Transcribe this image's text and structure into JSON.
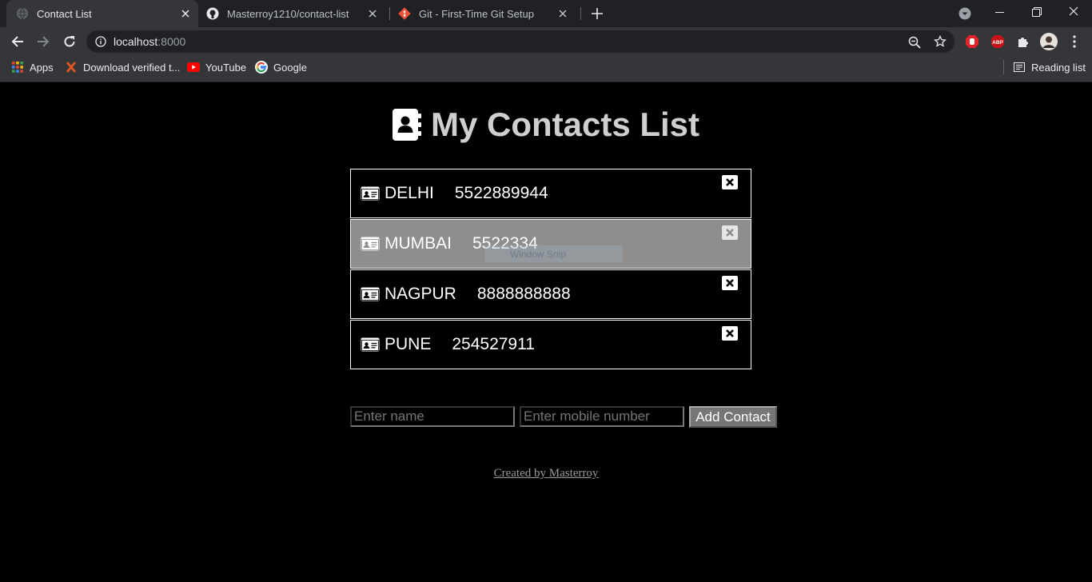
{
  "browser": {
    "tabs": [
      {
        "title": "Contact List",
        "favicon": "globe-icon",
        "active": true
      },
      {
        "title": "Masterroy1210/contact-list",
        "favicon": "github-icon",
        "active": false
      },
      {
        "title": "Git - First-Time Git Setup",
        "favicon": "git-icon",
        "active": false
      }
    ],
    "url_host": "localhost",
    "url_port": ":8000",
    "bookmarks": [
      {
        "label": "Apps",
        "icon": "apps-grid-icon"
      },
      {
        "label": "Download verified t...",
        "icon": "x-logo-icon"
      },
      {
        "label": "YouTube",
        "icon": "youtube-icon"
      },
      {
        "label": "Google",
        "icon": "google-icon"
      }
    ],
    "reading_list": "Reading list"
  },
  "page": {
    "title": "My Contacts List",
    "contacts": [
      {
        "name": "DELHI",
        "phone": "5522889944",
        "hovered": false
      },
      {
        "name": "MUMBAI",
        "phone": "5522334",
        "hovered": true
      },
      {
        "name": "NAGPUR",
        "phone": "8888888888",
        "hovered": false
      },
      {
        "name": "PUNE",
        "phone": "254527911",
        "hovered": false
      }
    ],
    "form": {
      "name_placeholder": "Enter name",
      "mobile_placeholder": "Enter mobile number",
      "add_label": "Add Contact"
    },
    "credit": "Created by Masterroy",
    "overlay_snip": "Window Snip"
  },
  "colors": {
    "page_bg": "#000000",
    "hover_row": "#8e8e8e",
    "title": "#cfcfcf"
  }
}
